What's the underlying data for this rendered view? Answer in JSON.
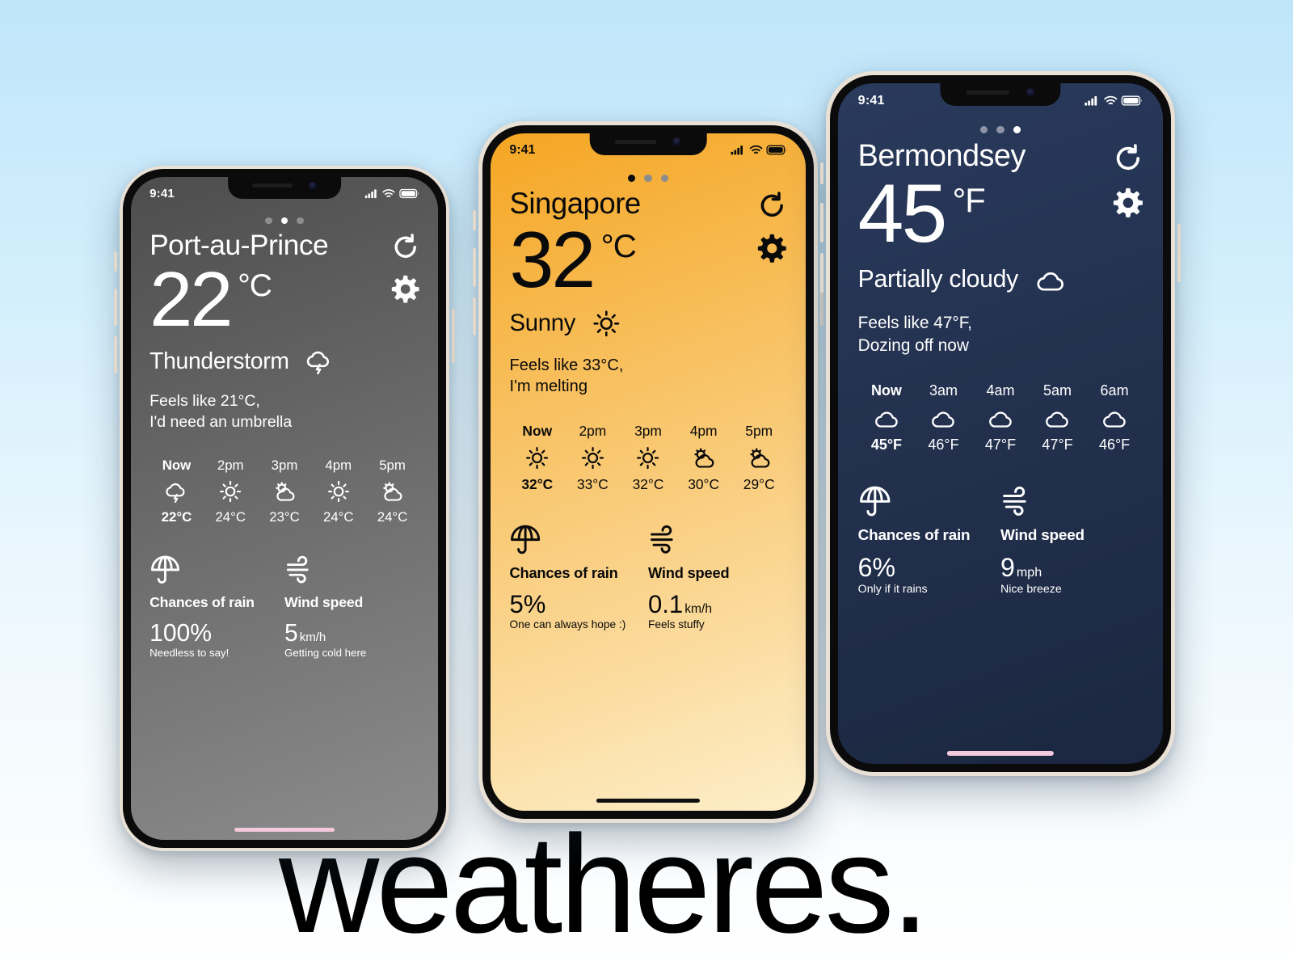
{
  "brand": {
    "wordmark": "weatheres."
  },
  "background": {
    "top_color": "#bfe6fa",
    "bottom_color": "#ffffff"
  },
  "phones": [
    {
      "id": "phone-port-au-prince",
      "theme": {
        "name": "grey",
        "bg_top": "#4d4d4d",
        "bg_bottom": "#8c8c8c",
        "text": "#ffffff",
        "dot_active": "#ffffff",
        "dot_inactive": "#8e8e8e",
        "home_bar": "#f3c9db"
      },
      "status": {
        "time": "9:41",
        "cellular": "signal-bars",
        "wifi": "wifi",
        "battery": "battery-full"
      },
      "pager": {
        "count": 3,
        "active_index": 1
      },
      "city": "Port-au-Prince",
      "refresh_label": "refresh",
      "settings_label": "settings",
      "temperature": "22",
      "unit": "°C",
      "condition": "Thunderstorm",
      "condition_icon": "thunderstorm",
      "feels_like": "Feels like 21°C,\nI'd need an umbrella",
      "hourly": [
        {
          "label": "Now",
          "icon": "thunderstorm",
          "temp": "22°C",
          "current": true
        },
        {
          "label": "2pm",
          "icon": "sunny",
          "temp": "24°C",
          "current": false
        },
        {
          "label": "3pm",
          "icon": "partly-cloudy",
          "temp": "23°C",
          "current": false
        },
        {
          "label": "4pm",
          "icon": "sunny",
          "temp": "24°C",
          "current": false
        },
        {
          "label": "5pm",
          "icon": "partly-cloudy",
          "temp": "24°C",
          "current": false
        }
      ],
      "rain": {
        "icon": "umbrella",
        "title": "Chances of rain",
        "value": "100%",
        "suffix": "",
        "note": "Needless to say!"
      },
      "wind": {
        "icon": "wind",
        "title": "Wind speed",
        "value": "5",
        "suffix": "km/h",
        "note": "Getting cold here"
      }
    },
    {
      "id": "phone-singapore",
      "theme": {
        "name": "orange",
        "bg_top": "#f5a623",
        "bg_bottom": "#fdeec9",
        "text": "#0a0a0a",
        "dot_active": "#0a0a0a",
        "dot_inactive": "#8c8c8c",
        "home_bar": "#101010"
      },
      "status": {
        "time": "9:41",
        "cellular": "signal-bars",
        "wifi": "wifi",
        "battery": "battery-full"
      },
      "pager": {
        "count": 3,
        "active_index": 0
      },
      "city": "Singapore",
      "refresh_label": "refresh",
      "settings_label": "settings",
      "temperature": "32",
      "unit": "°C",
      "condition": "Sunny",
      "condition_icon": "sunny",
      "feels_like": "Feels like 33°C,\nI'm melting",
      "hourly": [
        {
          "label": "Now",
          "icon": "sunny",
          "temp": "32°C",
          "current": true
        },
        {
          "label": "2pm",
          "icon": "sunny",
          "temp": "33°C",
          "current": false
        },
        {
          "label": "3pm",
          "icon": "sunny",
          "temp": "32°C",
          "current": false
        },
        {
          "label": "4pm",
          "icon": "partly-cloudy",
          "temp": "30°C",
          "current": false
        },
        {
          "label": "5pm",
          "icon": "partly-cloudy",
          "temp": "29°C",
          "current": false
        }
      ],
      "rain": {
        "icon": "umbrella",
        "title": "Chances of rain",
        "value": "5%",
        "suffix": "",
        "note": "One can always hope :)"
      },
      "wind": {
        "icon": "wind",
        "title": "Wind speed",
        "value": "0.1",
        "suffix": "km/h",
        "note": "Feels stuffy"
      }
    },
    {
      "id": "phone-bermondsey",
      "theme": {
        "name": "navy",
        "bg_top": "#2a3a5c",
        "bg_bottom": "#1b2740",
        "text": "#ffffff",
        "dot_active": "#ffffff",
        "dot_inactive": "#8d94a6",
        "home_bar": "#f3c9db"
      },
      "status": {
        "time": "9:41",
        "cellular": "signal-bars",
        "wifi": "wifi",
        "battery": "battery-full"
      },
      "pager": {
        "count": 3,
        "active_index": 2
      },
      "city": "Bermondsey",
      "refresh_label": "refresh",
      "settings_label": "settings",
      "temperature": "45",
      "unit": "°F",
      "condition": "Partially cloudy",
      "condition_icon": "cloudy",
      "feels_like": "Feels like 47°F,\nDozing off now",
      "hourly": [
        {
          "label": "Now",
          "icon": "cloudy",
          "temp": "45°F",
          "current": true
        },
        {
          "label": "3am",
          "icon": "cloudy",
          "temp": "46°F",
          "current": false
        },
        {
          "label": "4am",
          "icon": "cloudy",
          "temp": "47°F",
          "current": false
        },
        {
          "label": "5am",
          "icon": "cloudy",
          "temp": "47°F",
          "current": false
        },
        {
          "label": "6am",
          "icon": "cloudy",
          "temp": "46°F",
          "current": false
        }
      ],
      "rain": {
        "icon": "umbrella",
        "title": "Chances of rain",
        "value": "6%",
        "suffix": "",
        "note": "Only if it rains"
      },
      "wind": {
        "icon": "wind",
        "title": "Wind speed",
        "value": "9",
        "suffix": "mph",
        "note": "Nice breeze"
      }
    }
  ]
}
